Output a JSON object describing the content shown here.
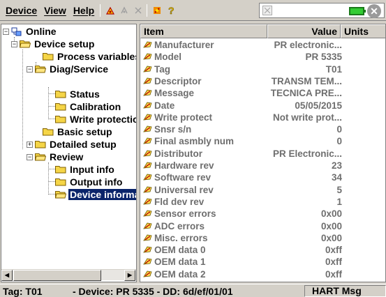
{
  "menu": {
    "device": "Device",
    "view": "View",
    "help": "Help"
  },
  "toolbar": {
    "buttons": [
      "connect-icon",
      "disconnect-icon",
      "refresh-icon",
      "tools-icon",
      "help-question-icon"
    ],
    "help_glyph": "?"
  },
  "status_box": {
    "battery_color": "#33cc33",
    "close_glyph": "✕"
  },
  "tree": {
    "nodes": [
      {
        "label": "Online",
        "icon": "online-device-icon"
      },
      {
        "label": "Device setup",
        "icon": "folder-open-icon"
      },
      {
        "label": "Process variables",
        "icon": "folder-icon"
      },
      {
        "label": "Diag/Service",
        "icon": "folder-open-icon"
      },
      {
        "label": "Status",
        "icon": "folder-icon"
      },
      {
        "label": "Calibration",
        "icon": "folder-icon"
      },
      {
        "label": "Write protection",
        "icon": "folder-icon"
      },
      {
        "label": "Basic setup",
        "icon": "folder-icon"
      },
      {
        "label": "Detailed setup",
        "icon": "folder-icon"
      },
      {
        "label": "Review",
        "icon": "folder-open-icon"
      },
      {
        "label": "Input info",
        "icon": "folder-icon"
      },
      {
        "label": "Output info",
        "icon": "folder-icon"
      },
      {
        "label": "Device information",
        "icon": "folder-open-icon",
        "selected": true
      }
    ],
    "expanders": {
      "minus": "−",
      "plus": "+"
    }
  },
  "scrollbar": {
    "left_arrow": "◀",
    "right_arrow": "▶"
  },
  "list": {
    "columns": {
      "item": "Item",
      "value": "Value",
      "units": "Units"
    },
    "rows": [
      {
        "item": "Manufacturer",
        "value": "PR electronic..."
      },
      {
        "item": "Model",
        "value": "PR 5335"
      },
      {
        "item": "Tag",
        "value": "T01"
      },
      {
        "item": "Descriptor",
        "value": "TRANSM TEM..."
      },
      {
        "item": "Message",
        "value": "TECNICA PRE..."
      },
      {
        "item": "Date",
        "value": "05/05/2015"
      },
      {
        "item": "Write protect",
        "value": "Not write prot..."
      },
      {
        "item": "Snsr s/n",
        "value": "0"
      },
      {
        "item": "Final asmbly num",
        "value": "0"
      },
      {
        "item": "Distributor",
        "value": "PR Electronic..."
      },
      {
        "item": "Hardware rev",
        "value": "23"
      },
      {
        "item": "Software rev",
        "value": "34"
      },
      {
        "item": "Universal rev",
        "value": "5"
      },
      {
        "item": "Fld dev rev",
        "value": "1"
      },
      {
        "item": "Sensor errors",
        "value": "0x00"
      },
      {
        "item": "ADC errors",
        "value": "0x00"
      },
      {
        "item": "Misc. errors",
        "value": "0x00"
      },
      {
        "item": "OEM data 0",
        "value": "0xff"
      },
      {
        "item": "OEM data 1",
        "value": "0xff"
      },
      {
        "item": "OEM data 2",
        "value": "0xff"
      }
    ]
  },
  "statusbar": {
    "tag": "Tag: T01",
    "device": "- Device: PR 5335 - DD: 6d/ef/01/01",
    "hart": "HART Msg"
  },
  "colors": {
    "selection": "#0a246a",
    "folder": "#f5d547",
    "value_text": "#6e6e6e"
  }
}
